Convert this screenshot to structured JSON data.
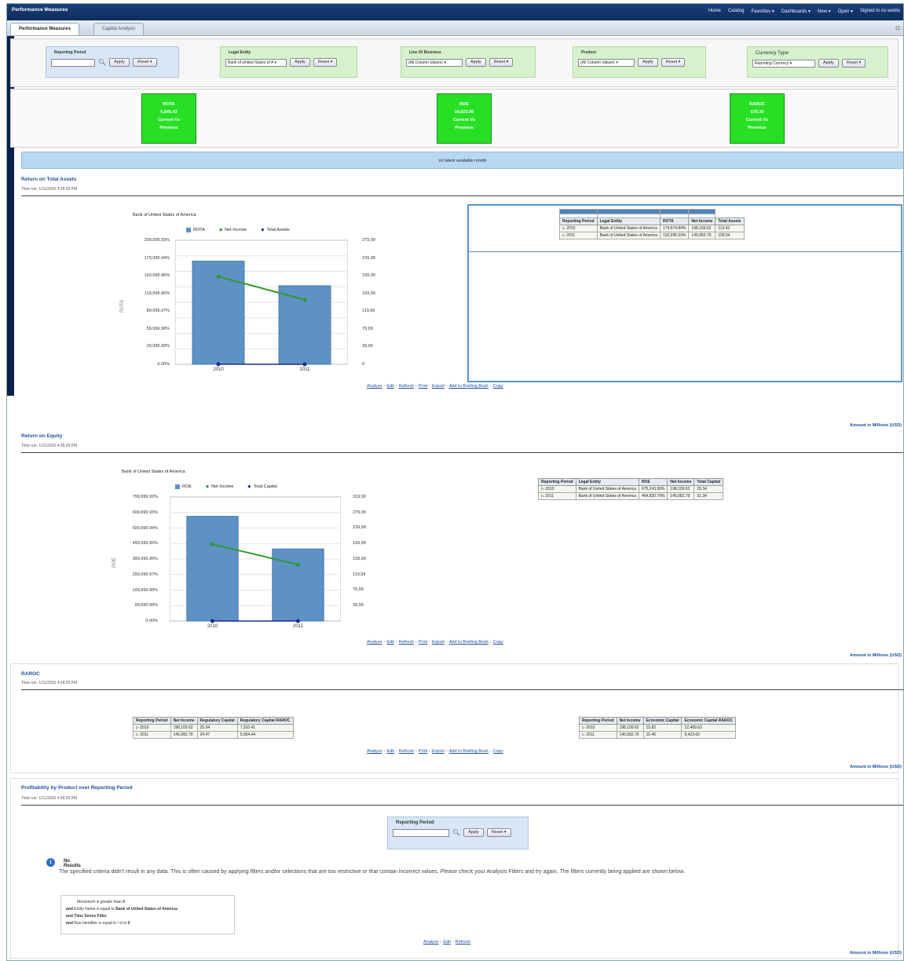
{
  "app": {
    "title": "Performance Measures",
    "nav": [
      "Home",
      "Catalog",
      "Favorites ▾",
      "Dashboards ▾",
      "New ▾",
      "Open ▾",
      "Signed In As weblo"
    ]
  },
  "tabs": [
    "Performance Measures",
    "Capital Analysis"
  ],
  "filters": [
    {
      "label": "Reporting Period",
      "value": "",
      "apply": "Apply",
      "reset": "Reset ▾"
    },
    {
      "label": "Legal Entity",
      "value": "Bank of United States of A ▾",
      "apply": "Apply",
      "reset": "Reset ▾"
    },
    {
      "label": "Line Of Business",
      "value": "(All Column Values) ▾",
      "apply": "Apply",
      "reset": "Reset ▾"
    },
    {
      "label": "Product",
      "value": "(All Column Values) ▾",
      "apply": "Apply",
      "reset": "Reset ▾"
    },
    {
      "label": "Currency Type",
      "value": "Reporting Currency ▾",
      "apply": "Apply",
      "reset": "Reset ▾"
    }
  ],
  "kpis": [
    {
      "name": "ROTA",
      "value": "6,845.43",
      "line1": "Current Vs",
      "line2": "Previous",
      "color": "#27e024"
    },
    {
      "name": "ROE",
      "value": "24,023.86",
      "line1": "Current Vs",
      "line2": "Previous",
      "color": "#27e024"
    },
    {
      "name": "RAROC",
      "value": "576.30",
      "line1": "Current Vs",
      "line2": "Previous",
      "color": "#27e024"
    }
  ],
  "banner": "on latest available month",
  "links": [
    "Analyze",
    "Edit",
    "Refresh",
    "Print",
    "Export",
    "Add to Briefing Book",
    "Copy"
  ],
  "links_short": [
    "Analyze",
    "Edit",
    "Refresh"
  ],
  "amount_note": "Amount in Millions (USD)",
  "rota": {
    "title": "Return on Total Assets",
    "time_run": "Time run: 1/11/2016 4:28:29 PM",
    "chart_title": "Bank of United States of America",
    "y_axis_title": "ROTA",
    "legend": [
      "ROTA",
      "Net Income",
      "Total Assets"
    ],
    "y_ticks": [
      "209,999.93%",
      "179,999.94%",
      "149,999.95%",
      "119,999.96%",
      "89,999.97%",
      "59,999.98%",
      "29,999.99%",
      "0.00%"
    ],
    "y2_ticks": [
      "279,99",
      "239,99",
      "199,99",
      "159,99",
      "119,99",
      "79,99",
      "39,99",
      "0"
    ],
    "table": {
      "headers": [
        "Reporting Period",
        "Legal Entity",
        "ROTA",
        "Net Income",
        "Total Assets"
      ],
      "rows": [
        [
          "2010",
          "Bank of United States of America",
          "174,674.84%",
          "198,109.62",
          "113.42"
        ],
        [
          "2011",
          "Bank of United States of America",
          "132,995.03%",
          "145,682.79",
          "109.54"
        ]
      ]
    }
  },
  "roe": {
    "title": "Return on Equity",
    "time_run": "Time run: 1/11/2016 4:28:29 PM",
    "chart_title": "Bank of United States of America",
    "y_axis_title": "ROE",
    "legend": [
      "ROE",
      "Net Income",
      "Total Capital"
    ],
    "y_ticks": [
      "799,999.92%",
      "699,999.93%",
      "599,999.94%",
      "499,999.95%",
      "399,999.96%",
      "299,999.97%",
      "199,999.98%",
      "99,999.99%",
      "0.00%"
    ],
    "y2_ticks": [
      "319,99",
      "279,99",
      "239,99",
      "199,99",
      "159,99",
      "119,99",
      "79,99",
      "39,99"
    ],
    "table": {
      "headers": [
        "Reporting Period",
        "Legal Entity",
        "ROE",
        "Net Income",
        "Total Capital"
      ],
      "rows": [
        [
          "2010",
          "Bank of United States of America",
          "675,243.99%",
          "198,109.62",
          "29.34"
        ],
        [
          "2011",
          "Bank of United States of America",
          "464,820.79%",
          "145,682.79",
          "31.34"
        ]
      ]
    }
  },
  "raroc": {
    "title": "RAROC",
    "time_run": "Time run: 1/11/2016 4:28:29 PM",
    "reg_table": {
      "headers": [
        "Reporting Period",
        "Net Income",
        "Regulatory Capital",
        "Regulatory Capital RAROC"
      ],
      "rows": [
        [
          "2010",
          "198,109.62",
          "25.04",
          "7,910.41"
        ],
        [
          "2011",
          "145,682.79",
          "24.47",
          "5,954.44"
        ]
      ]
    },
    "eco_table": {
      "headers": [
        "Reporting Period",
        "Net Income",
        "Economic Capital",
        "Economic Capital RAROC"
      ],
      "rows": [
        [
          "2010",
          "198,109.62",
          "15.82",
          "12,489.63"
        ],
        [
          "2011",
          "145,682.79",
          "15.46",
          "9,423.60"
        ]
      ]
    }
  },
  "profit": {
    "title": "Profitability by Product over Reporting Period",
    "time_run": "Time run: 1/11/2016 4:28:29 PM",
    "filter_label": "Reporting Period",
    "apply": "Apply",
    "reset": "Reset ▾",
    "no_results_title": "No Results",
    "no_results_msg": "The specified criteria didn't result in any data. This is often caused by applying filters and/or selections that are too restrictive or that contain incorrect values. Please check your Analysis Filters and try again. The filters currently being applied are shown below.",
    "applied_filters": [
      {
        "prefix": "",
        "text": "Movement is greater than ",
        "bold": "0"
      },
      {
        "prefix": "and",
        "text": "Entity Name is equal to ",
        "bold": "Bank of United States of America"
      },
      {
        "prefix": "and",
        "text": "",
        "bold": "Time Series Filter"
      },
      {
        "prefix": "and",
        "text": "Run Identifier is equal to / is in ",
        "bold": "0"
      }
    ]
  },
  "chart_data": [
    {
      "type": "bar",
      "title": "Bank of United States of America",
      "ylabel": "ROTA",
      "categories": [
        "2010",
        "2011"
      ],
      "series": [
        {
          "name": "ROTA",
          "values": [
            174674.84,
            132995.03
          ],
          "axis": "left",
          "color": "#5e91c4"
        },
        {
          "name": "Net Income",
          "values": [
            198109.62,
            145682.79
          ],
          "axis": "right",
          "color": "#2e9a2e"
        },
        {
          "name": "Total Assets",
          "values": [
            113.42,
            109.54
          ],
          "axis": "right",
          "color": "#1a2f8a"
        }
      ],
      "ylim": [
        0,
        209999.93
      ],
      "y2lim": [
        0,
        279999
      ]
    },
    {
      "type": "bar",
      "title": "Bank of United States of America",
      "ylabel": "ROE",
      "categories": [
        "2010",
        "2011"
      ],
      "series": [
        {
          "name": "ROE",
          "values": [
            675243.99,
            464820.79
          ],
          "axis": "left",
          "color": "#5e91c4"
        },
        {
          "name": "Net Income",
          "values": [
            198109.62,
            145682.79
          ],
          "axis": "right",
          "color": "#2e9a2e"
        },
        {
          "name": "Total Capital",
          "values": [
            29.34,
            31.34
          ],
          "axis": "right",
          "color": "#1a2f8a"
        }
      ],
      "ylim": [
        0,
        799999.92
      ],
      "y2lim": [
        0,
        319999
      ]
    }
  ]
}
